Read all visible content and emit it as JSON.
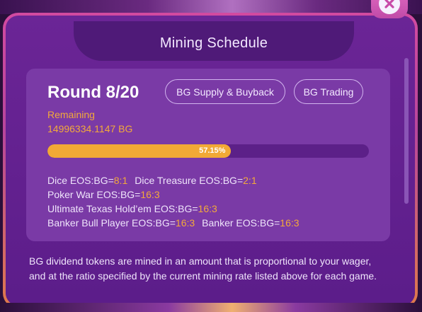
{
  "modal": {
    "title": "Mining Schedule",
    "close_icon": "close-icon"
  },
  "round": {
    "title": "Round 8/20",
    "remaining_label": "Remaining",
    "remaining_value": "14996334.1147 BG"
  },
  "buttons": {
    "supply": "BG Supply & Buyback",
    "trading": "BG Trading"
  },
  "progress": {
    "percent": 57.15,
    "label": "57.15%"
  },
  "ratios": [
    [
      {
        "game": "Dice EOS:BG=",
        "ratio": "8:1"
      },
      {
        "game": "Dice Treasure EOS:BG=",
        "ratio": "2:1"
      }
    ],
    [
      {
        "game": "Poker War EOS:BG=",
        "ratio": "16:3"
      }
    ],
    [
      {
        "game": "Ultimate Texas Hold’em EOS:BG=",
        "ratio": "16:3"
      }
    ],
    [
      {
        "game": "Banker Bull Player EOS:BG=",
        "ratio": "16:3"
      },
      {
        "game": "Banker EOS:BG=",
        "ratio": "16:3"
      }
    ]
  ],
  "description": {
    "line1": "BG dividend tokens are mined in an amount that is proportional to your wager,",
    "line2": "and at the ratio specified by the current mining rate listed above for each game."
  },
  "colors": {
    "accent_orange": "#f3a93a",
    "panel_purple": "#5c1d8a",
    "card_purple": "#7a3aa6",
    "frame_pink": "#d24aa0"
  }
}
